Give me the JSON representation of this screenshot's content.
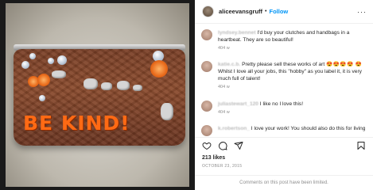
{
  "post": {
    "username": "aliceevansgruff",
    "separator": "•",
    "follow_label": "Follow",
    "more_label": "···",
    "image_text": "BE KIND!",
    "likes": "213 likes",
    "date": "OCTOBER 23, 2015",
    "comments_disabled": "Comments on this post have been limited."
  },
  "comments": [
    {
      "user": "lyndsey.bennet",
      "text": "I'd buy your clutches and handbags in a heartbeat. They are so beautiful!",
      "time": "404 w"
    },
    {
      "user": "katie.c.b.",
      "text": "Pretty please sell these works of art",
      "emojis_inline": "😍😍😍😍",
      "emojis_start": "😍",
      "text2": "Whilst I love all your jobs, this \"hobby\" as you label it, it is very much full of talent!",
      "time": "404 w"
    },
    {
      "user": "juliastewart_120",
      "text": "I like no I love this!",
      "time": "404 w"
    },
    {
      "user": "k.robertson_",
      "text": "I love your work! You should also do this for living",
      "time": ""
    }
  ],
  "icons": {
    "like": "heart-icon",
    "comment": "comment-icon",
    "share": "share-icon",
    "save": "bookmark-icon"
  },
  "colors": {
    "follow": "#0095f6",
    "text_accent": "#ff6a14"
  }
}
